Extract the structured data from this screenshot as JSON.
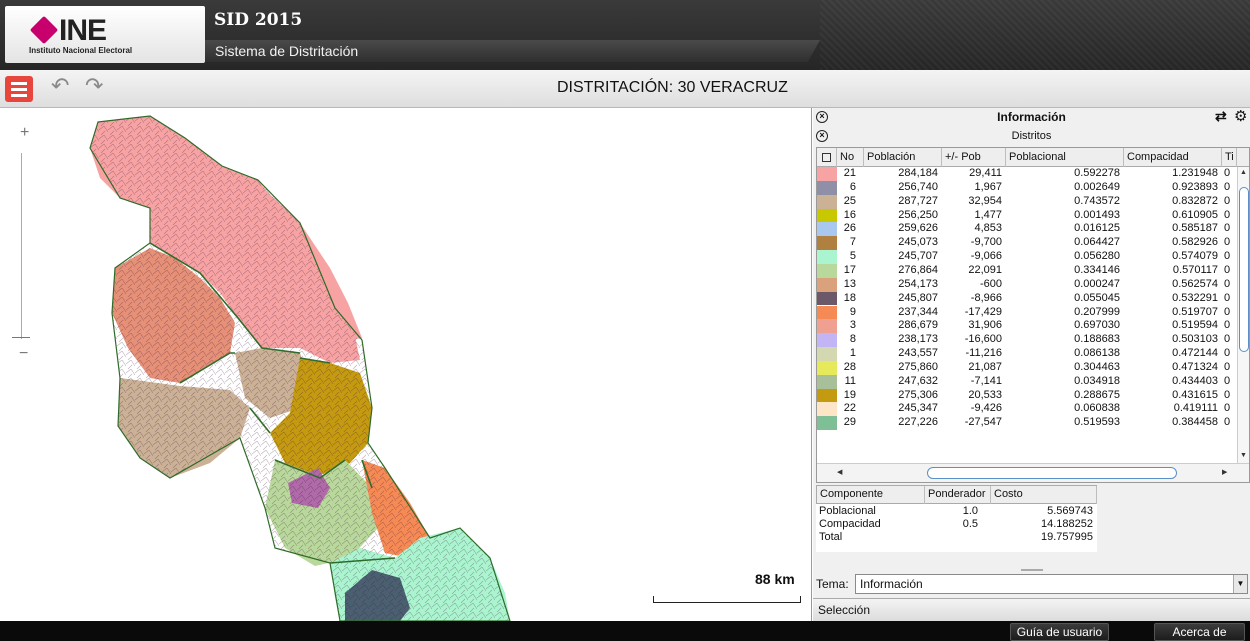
{
  "header": {
    "logo_text": "INE",
    "logo_sub": "Instituto Nacional Electoral",
    "app_name": "SID 2015",
    "app_subtitle": "Sistema de Distritación"
  },
  "toolbar": {
    "menu_icon": "hamburger-icon",
    "undo_icon": "undo-icon",
    "redo_icon": "redo-icon",
    "title": "DISTRITACIÓN: 30 VERACRUZ"
  },
  "map": {
    "zoom_in": "+",
    "zoom_out": "−",
    "scale_label": "88 km"
  },
  "panel": {
    "title": "Información",
    "tab": "Distritos",
    "columns": [
      "No",
      "Población",
      "+/- Pob",
      "Poblacional",
      "Compacidad",
      "Ti"
    ],
    "rows": [
      {
        "no": "21",
        "pob": "284,184",
        "dif": "29,411",
        "pcl": "0.592278",
        "cmp": "1.231948",
        "ti": "0",
        "color": "#f7a3a3"
      },
      {
        "no": "6",
        "pob": "256,740",
        "dif": "1,967",
        "pcl": "0.002649",
        "cmp": "0.923893",
        "ti": "0",
        "color": "#8f8fa8"
      },
      {
        "no": "25",
        "pob": "287,727",
        "dif": "32,954",
        "pcl": "0.743572",
        "cmp": "0.832872",
        "ti": "0",
        "color": "#cbb195"
      },
      {
        "no": "16",
        "pob": "256,250",
        "dif": "1,477",
        "pcl": "0.001493",
        "cmp": "0.610905",
        "ti": "0",
        "color": "#c8c800"
      },
      {
        "no": "26",
        "pob": "259,626",
        "dif": "4,853",
        "pcl": "0.016125",
        "cmp": "0.585187",
        "ti": "0",
        "color": "#a9c8f0"
      },
      {
        "no": "7",
        "pob": "245,073",
        "dif": "-9,700",
        "pcl": "0.064427",
        "cmp": "0.582926",
        "ti": "0",
        "color": "#b08040"
      },
      {
        "no": "5",
        "pob": "245,707",
        "dif": "-9,066",
        "pcl": "0.056280",
        "cmp": "0.574079",
        "ti": "0",
        "color": "#aaf5cf"
      },
      {
        "no": "17",
        "pob": "276,864",
        "dif": "22,091",
        "pcl": "0.334146",
        "cmp": "0.570117",
        "ti": "0",
        "color": "#b9d89b"
      },
      {
        "no": "13",
        "pob": "254,173",
        "dif": "-600",
        "pcl": "0.000247",
        "cmp": "0.562574",
        "ti": "0",
        "color": "#d9a27c"
      },
      {
        "no": "18",
        "pob": "245,807",
        "dif": "-8,966",
        "pcl": "0.055045",
        "cmp": "0.532291",
        "ti": "0",
        "color": "#6b5868"
      },
      {
        "no": "9",
        "pob": "237,344",
        "dif": "-17,429",
        "pcl": "0.207999",
        "cmp": "0.519707",
        "ti": "0",
        "color": "#f58a55"
      },
      {
        "no": "3",
        "pob": "286,679",
        "dif": "31,906",
        "pcl": "0.697030",
        "cmp": "0.519594",
        "ti": "0",
        "color": "#f0a090"
      },
      {
        "no": "8",
        "pob": "238,173",
        "dif": "-16,600",
        "pcl": "0.188683",
        "cmp": "0.503103",
        "ti": "0",
        "color": "#c3b4f5"
      },
      {
        "no": "1",
        "pob": "243,557",
        "dif": "-11,216",
        "pcl": "0.086138",
        "cmp": "0.472144",
        "ti": "0",
        "color": "#d4d8b0"
      },
      {
        "no": "28",
        "pob": "275,860",
        "dif": "21,087",
        "pcl": "0.304463",
        "cmp": "0.471324",
        "ti": "0",
        "color": "#e6ea5a"
      },
      {
        "no": "11",
        "pob": "247,632",
        "dif": "-7,141",
        "pcl": "0.034918",
        "cmp": "0.434403",
        "ti": "0",
        "color": "#a8c09a"
      },
      {
        "no": "19",
        "pob": "275,306",
        "dif": "20,533",
        "pcl": "0.288675",
        "cmp": "0.431615",
        "ti": "0",
        "color": "#c49a10"
      },
      {
        "no": "22",
        "pob": "245,347",
        "dif": "-9,426",
        "pcl": "0.060838",
        "cmp": "0.419111",
        "ti": "0",
        "color": "#fde6c8"
      },
      {
        "no": "29",
        "pob": "227,226",
        "dif": "-27,547",
        "pcl": "0.519593",
        "cmp": "0.384458",
        "ti": "0",
        "color": "#7fbf95"
      }
    ],
    "cost_columns": [
      "Componente",
      "Ponderador",
      "Costo"
    ],
    "cost_rows": [
      {
        "componente": "Poblacional",
        "ponderador": "1.0",
        "costo": "5.569743"
      },
      {
        "componente": "Compacidad",
        "ponderador": "0.5",
        "costo": "14.188252"
      },
      {
        "componente": "Total",
        "ponderador": "",
        "costo": "19.757995"
      }
    ],
    "tema_label": "Tema:",
    "tema_value": "Información",
    "seleccion": "Selección"
  },
  "footer": {
    "guide": "Guía de usuario",
    "about": "Acerca de"
  }
}
